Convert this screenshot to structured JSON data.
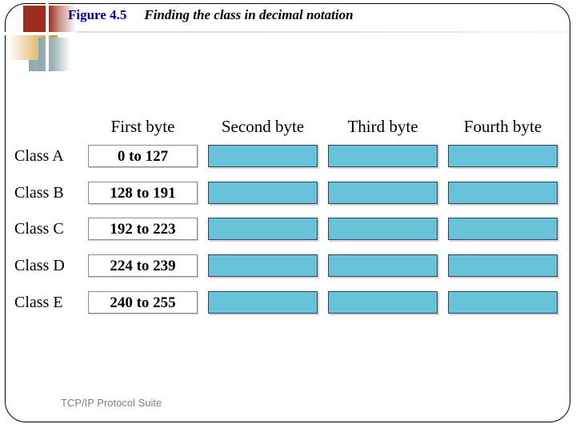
{
  "slide": {
    "figure_number": "Figure 4.5",
    "caption": "Finding the class in decimal notation",
    "footer": "TCP/IP Protocol Suite",
    "accent_blue": "#00008f",
    "box_cyan": "#68c3da",
    "ornament_red": "#9c2d1e",
    "ornament_gold": "#d9a441",
    "ornament_blue_gray": "#90a8ac"
  },
  "table": {
    "column_headers": [
      "First byte",
      "Second byte",
      "Third byte",
      "Fourth byte"
    ],
    "rows": [
      {
        "label": "Class A",
        "first_byte": "0 to 127"
      },
      {
        "label": "Class B",
        "first_byte": "128 to 191"
      },
      {
        "label": "Class C",
        "first_byte": "192 to 223"
      },
      {
        "label": "Class D",
        "first_byte": "224 to 239"
      },
      {
        "label": "Class E",
        "first_byte": "240 to 255"
      }
    ]
  }
}
